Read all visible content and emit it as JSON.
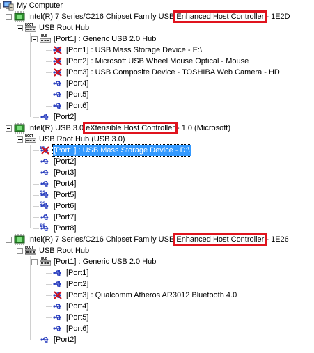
{
  "tree": {
    "root": "My Computer",
    "controllers": [
      {
        "name": "Intel(R) 7 Series/C216 Chipset Family USB Enhanced Host Controller - 1E2D",
        "root_hub": "USB Root Hub",
        "hub": "[Port1] : Generic USB 2.0 Hub",
        "hub_ports": [
          "[Port1] : USB Mass Storage Device - E:\\",
          "[Port2] : Microsoft USB Wheel Mouse Optical - Mouse",
          "[Port3] : USB Composite Device - TOSHIBA Web Camera - HD",
          "[Port4]",
          "[Port5]",
          "[Port6]"
        ],
        "root_port2": "[Port2]"
      },
      {
        "name": "Intel(R) USB 3.0 eXtensible Host Controller - 1.0 (Microsoft)",
        "root_hub": "USB Root Hub (USB 3.0)",
        "ports": [
          "[Port1] : USB Mass Storage Device - D:\\",
          "[Port2]",
          "[Port3]",
          "[Port4]",
          "[Port5]",
          "[Port6]",
          "[Port7]",
          "[Port8]"
        ]
      },
      {
        "name": "Intel(R) 7 Series/C216 Chipset Family USB Enhanced Host Controller - 1E26",
        "root_hub": "USB Root Hub",
        "hub": "[Port1] : Generic USB 2.0 Hub",
        "hub_ports": [
          "[Port1]",
          "[Port2]",
          "[Port3] : Qualcomm Atheros AR3012 Bluetooth 4.0",
          "[Port4]",
          "[Port5]",
          "[Port6]"
        ],
        "root_port2": "[Port2]"
      }
    ],
    "icon_text": {
      "root_hub": "ROOT",
      "hub": "HUB",
      "superspeed": "SS"
    }
  },
  "colors": {
    "highlight_box": "#e0141e",
    "selection": "#3399ff",
    "usb_icon": "#2a3fbf",
    "device_icon": "#d0101c"
  }
}
